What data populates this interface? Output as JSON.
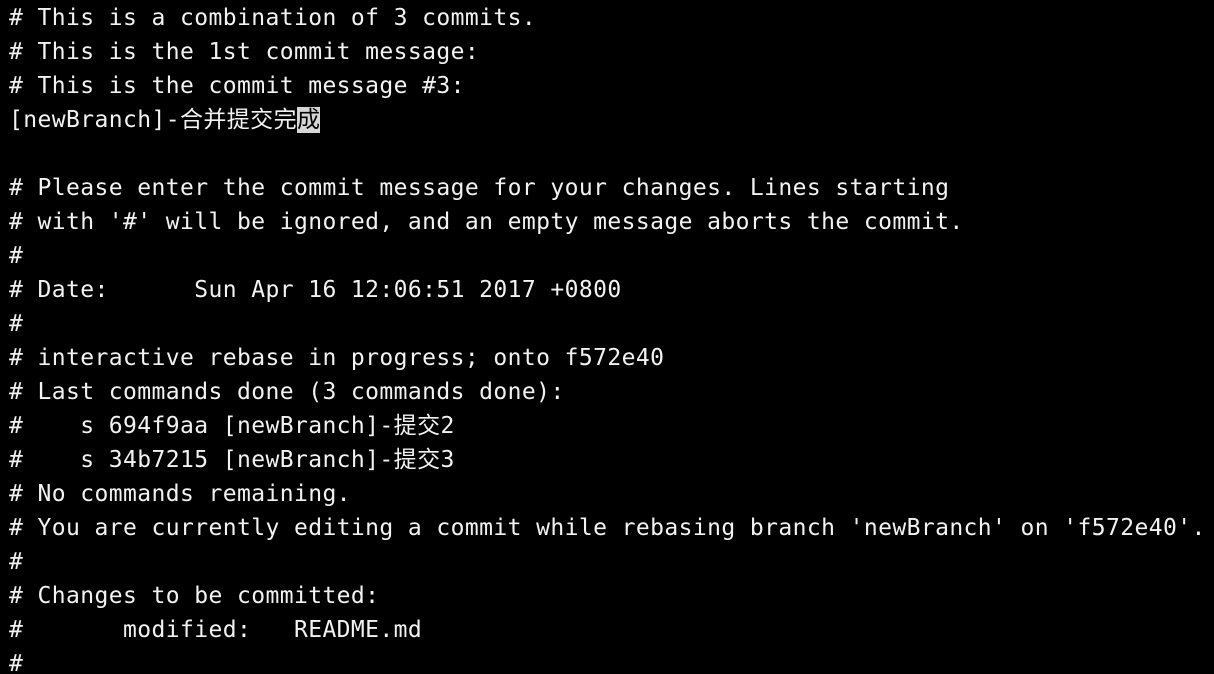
{
  "terminal": {
    "lines": [
      "# This is a combination of 3 commits.",
      "# This is the 1st commit message:",
      "# This is the commit message #3:",
      "",
      "",
      "# Please enter the commit message for your changes. Lines starting",
      "# with '#' will be ignored, and an empty message aborts the commit.",
      "#",
      "# Date:      Sun Apr 16 12:06:51 2017 +0800",
      "#",
      "# interactive rebase in progress; onto f572e40",
      "# Last commands done (3 commands done):",
      "#    s 694f9aa [newBranch]-提交2",
      "#    s 34b7215 [newBranch]-提交3",
      "# No commands remaining.",
      "# You are currently editing a commit while rebasing branch 'newBranch' on 'f572e40'.",
      "#",
      "# Changes to be committed:",
      "#       modified:   README.md",
      "#"
    ],
    "message_line": {
      "text_before_cursor": "[newBranch]-合并提交完",
      "cursor_char": "成"
    }
  },
  "colors": {
    "background": "#000000",
    "text": "#f2f2f2",
    "cursor": "#d6d6d6"
  }
}
